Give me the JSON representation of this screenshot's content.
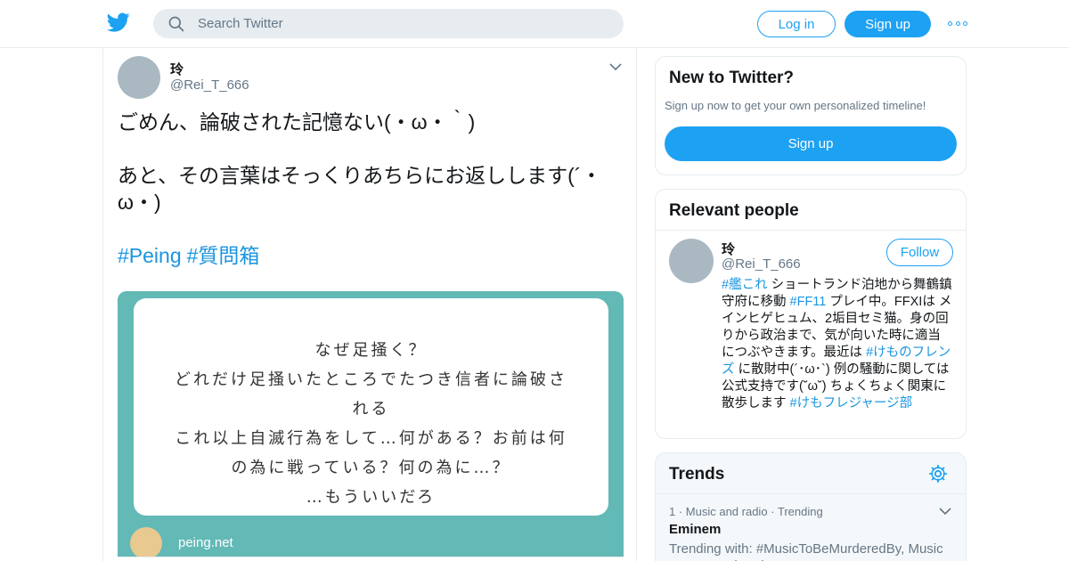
{
  "colors": {
    "accent": "#1da1f2",
    "link": "#1b95e0",
    "card_bg": "#63b9b6",
    "muted": "#657786"
  },
  "header": {
    "logo_icon": "twitter-bird-icon",
    "search_placeholder": "Search Twitter",
    "login_label": "Log in",
    "signup_label": "Sign up",
    "more_icon": "more-dots-icon"
  },
  "tweet": {
    "name": "玲",
    "handle": "@Rei_T_666",
    "text": "ごめん、論破された記憶ない(・ω・｀)\n\nあと、その言葉はそっくりあちらにお返しします(´・ω・)",
    "hashtags": [
      "#Peing",
      "#質問箱"
    ],
    "card": {
      "lines": [
        "なぜ足掻く？",
        "どれだけ足掻いたところでたつき信者に論破さ",
        "れる",
        "これ以上自滅行為をして…何がある？お前は何",
        "の為に戦っている？何の為に…？",
        "…もういいだろ"
      ],
      "site": "peing.net"
    }
  },
  "sidebar": {
    "new": {
      "title": "New to Twitter?",
      "subtitle": "Sign up now to get your own personalized timeline!",
      "button": "Sign up"
    },
    "relevant": {
      "title": "Relevant people",
      "name": "玲",
      "handle": "@Rei_T_666",
      "follow_label": "Follow",
      "bio": {
        "link1": "#艦これ",
        "t1": " ショートランド泊地から舞鶴鎮守府に移動 ",
        "link2": "#FF11",
        "t2": " プレイ中。FFXIは メインヒゲヒュム、2垢目セミ猫。身の回りから政治まで、気が向いた時に適当につぶやきます。最近は ",
        "link3": "#けものフレンズ",
        "t3": " に散財中(´･ω･`) 例の騒動に関しては公式支持です(˘ω˘) ちょくちょく関東に散歩します ",
        "link4": "#けもフレジャージ部"
      }
    },
    "trends": {
      "title": "Trends",
      "item": {
        "meta": "1 · Music and radio · Trending",
        "name": "Eminem",
        "desc": "Trending with: #MusicToBeMurderedBy, Music To Be Murdered By"
      }
    }
  }
}
